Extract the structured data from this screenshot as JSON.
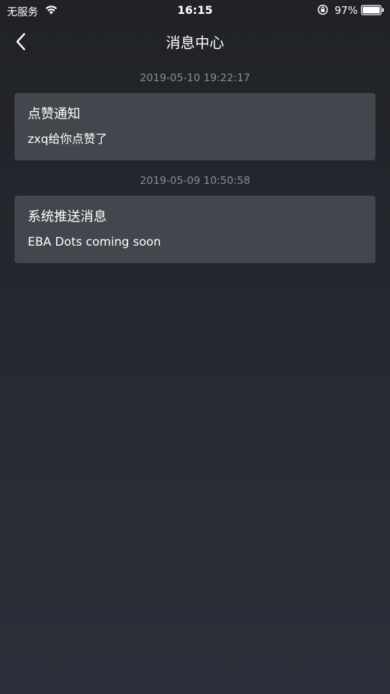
{
  "status_bar": {
    "carrier": "无服务",
    "time": "16:15",
    "battery": "97%"
  },
  "nav": {
    "title": "消息中心"
  },
  "messages": [
    {
      "timestamp": "2019-05-10 19:22:17",
      "title": "点赞通知",
      "body": "zxq给你点赞了"
    },
    {
      "timestamp": "2019-05-09 10:50:58",
      "title": "系统推送消息",
      "body": "EBA Dots coming soon"
    }
  ],
  "colors": {
    "background": "#25282f",
    "card": "#44464d",
    "timestamp": "#8a8d93"
  },
  "icons": [
    "wifi-icon",
    "orientation-lock-icon",
    "battery-icon",
    "back-chevron-icon"
  ]
}
